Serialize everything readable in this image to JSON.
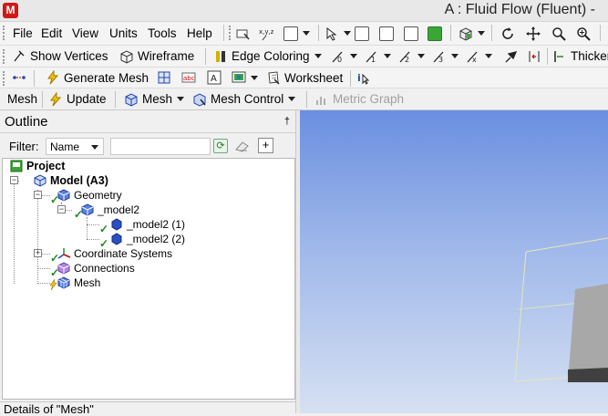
{
  "window": {
    "title": "A : Fluid Flow (Fluent) -",
    "logo": "M"
  },
  "menu": [
    "File",
    "Edit",
    "View",
    "Units",
    "Tools",
    "Help"
  ],
  "toolbar2": {
    "show_vertices": "Show Vertices",
    "wireframe": "Wireframe",
    "edge_coloring": "Edge Coloring",
    "thicken": "Thicken"
  },
  "toolbar3": {
    "generate_mesh": "Generate Mesh",
    "worksheet": "Worksheet"
  },
  "toolbar4": {
    "mesh_label": "Mesh",
    "update": "Update",
    "mesh_dropdown": "Mesh",
    "mesh_control": "Mesh Control",
    "metric_graph": "Metric Graph"
  },
  "outline": {
    "title": "Outline",
    "pin": "†",
    "filter_label": "Filter:",
    "filter_value": "Name",
    "filter_text": "",
    "tree": {
      "project": "Project",
      "model": "Model (A3)",
      "geometry": "Geometry",
      "part": "_model2",
      "body1": "_model2 (1)",
      "body2": "_model2 (2)",
      "coordinate_systems": "Coordinate Systems",
      "connections": "Connections",
      "mesh": "Mesh"
    }
  },
  "details": {
    "title": "Details of \"Mesh\""
  },
  "colors": {
    "accent_green": "#3aa635",
    "viewport_top": "#6b8fe0",
    "viewport_bottom": "#d6e0f2",
    "check": "#1e8a1e"
  },
  "icons": [
    "app-logo-icon",
    "cube-icon",
    "check-icon",
    "lightning-icon",
    "wireframe-icon",
    "edge-coloring-icon",
    "worksheet-icon",
    "refresh-icon",
    "pan-icon",
    "zoom-icon"
  ]
}
